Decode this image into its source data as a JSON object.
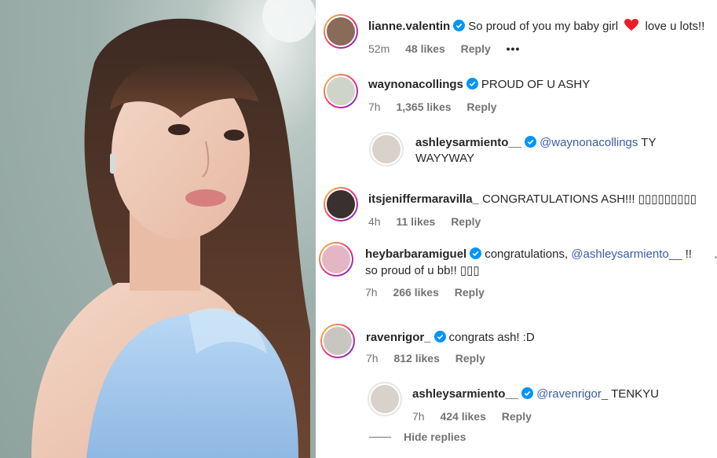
{
  "comments": [
    {
      "user": "lianne.valentin",
      "text_before": "So proud of you my baby girl",
      "emoji": "heart",
      "text_after": "love u lots!!",
      "time": "52m",
      "likes": "48 likes",
      "reply": "Reply",
      "more": "•••"
    },
    {
      "user": "waynonacollings",
      "text": "PROUD OF U ASHY",
      "time": "7h",
      "likes": "1,365 likes",
      "reply": "Reply"
    },
    {
      "user": "ashleysarmiento__",
      "mention": "@waynonacollings",
      "text": "TY",
      "text_line2": "WAYYWAY"
    },
    {
      "user": "itsjeniffermaravilla_",
      "text": "CONGRATULATIONS ASH!!! ▯▯▯▯▯▯▯▯▯",
      "time": "4h",
      "likes": "11 likes",
      "reply": "Reply"
    },
    {
      "user": "heybarbaramiguel",
      "text": "congratulations,",
      "mention": "@ashleysarmiento__",
      "text_after": "!!",
      "text_line2": "so proud of u bb!! ▯▯▯",
      "time": "7h",
      "likes": "266 likes",
      "reply": "Reply"
    },
    {
      "user": "ravenrigor_",
      "text": "congrats ash! :D",
      "time": "7h",
      "likes": "812 likes",
      "reply": "Reply"
    },
    {
      "user": "ashleysarmiento__",
      "mention": "@ravenrigor_",
      "text": "TENKYU",
      "time": "7h",
      "likes": "424 likes",
      "reply": "Reply"
    }
  ],
  "hide_replies": "Hide replies",
  "colors": {
    "verified": "#0095f6",
    "heart": "#ed1c24",
    "story_ring_start": "#f9ce34",
    "story_ring_end": "#6228d7"
  }
}
